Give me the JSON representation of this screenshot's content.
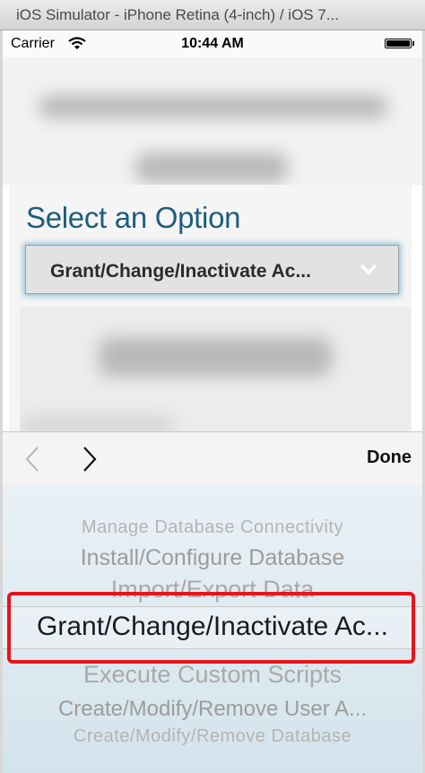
{
  "window": {
    "title": "iOS Simulator - iPhone Retina (4-inch) / iOS 7..."
  },
  "status_bar": {
    "carrier": "Carrier",
    "time": "10:44 AM",
    "wifi_icon": "wifi-icon",
    "battery_icon": "battery-icon"
  },
  "form": {
    "heading": "Select an Option",
    "select_value": "Grant/Change/Inactivate Ac...",
    "select_icon": "chevron-down-icon",
    "accent_color": "#1d5d7e"
  },
  "toolbar": {
    "prev_icon": "chevron-left-icon",
    "next_icon": "chevron-right-icon",
    "done_label": "Done"
  },
  "picker": {
    "rows_above": [
      "Manage Database Connectivity",
      "Install/Configure Database",
      "Import/Export Data"
    ],
    "selected": "Grant/Change/Inactivate Ac...",
    "rows_below": [
      "Execute Custom Scripts",
      "Create/Modify/Remove User A...",
      "Create/Modify/Remove Database"
    ]
  },
  "annotation": {
    "highlight_color": "#e8141b"
  }
}
